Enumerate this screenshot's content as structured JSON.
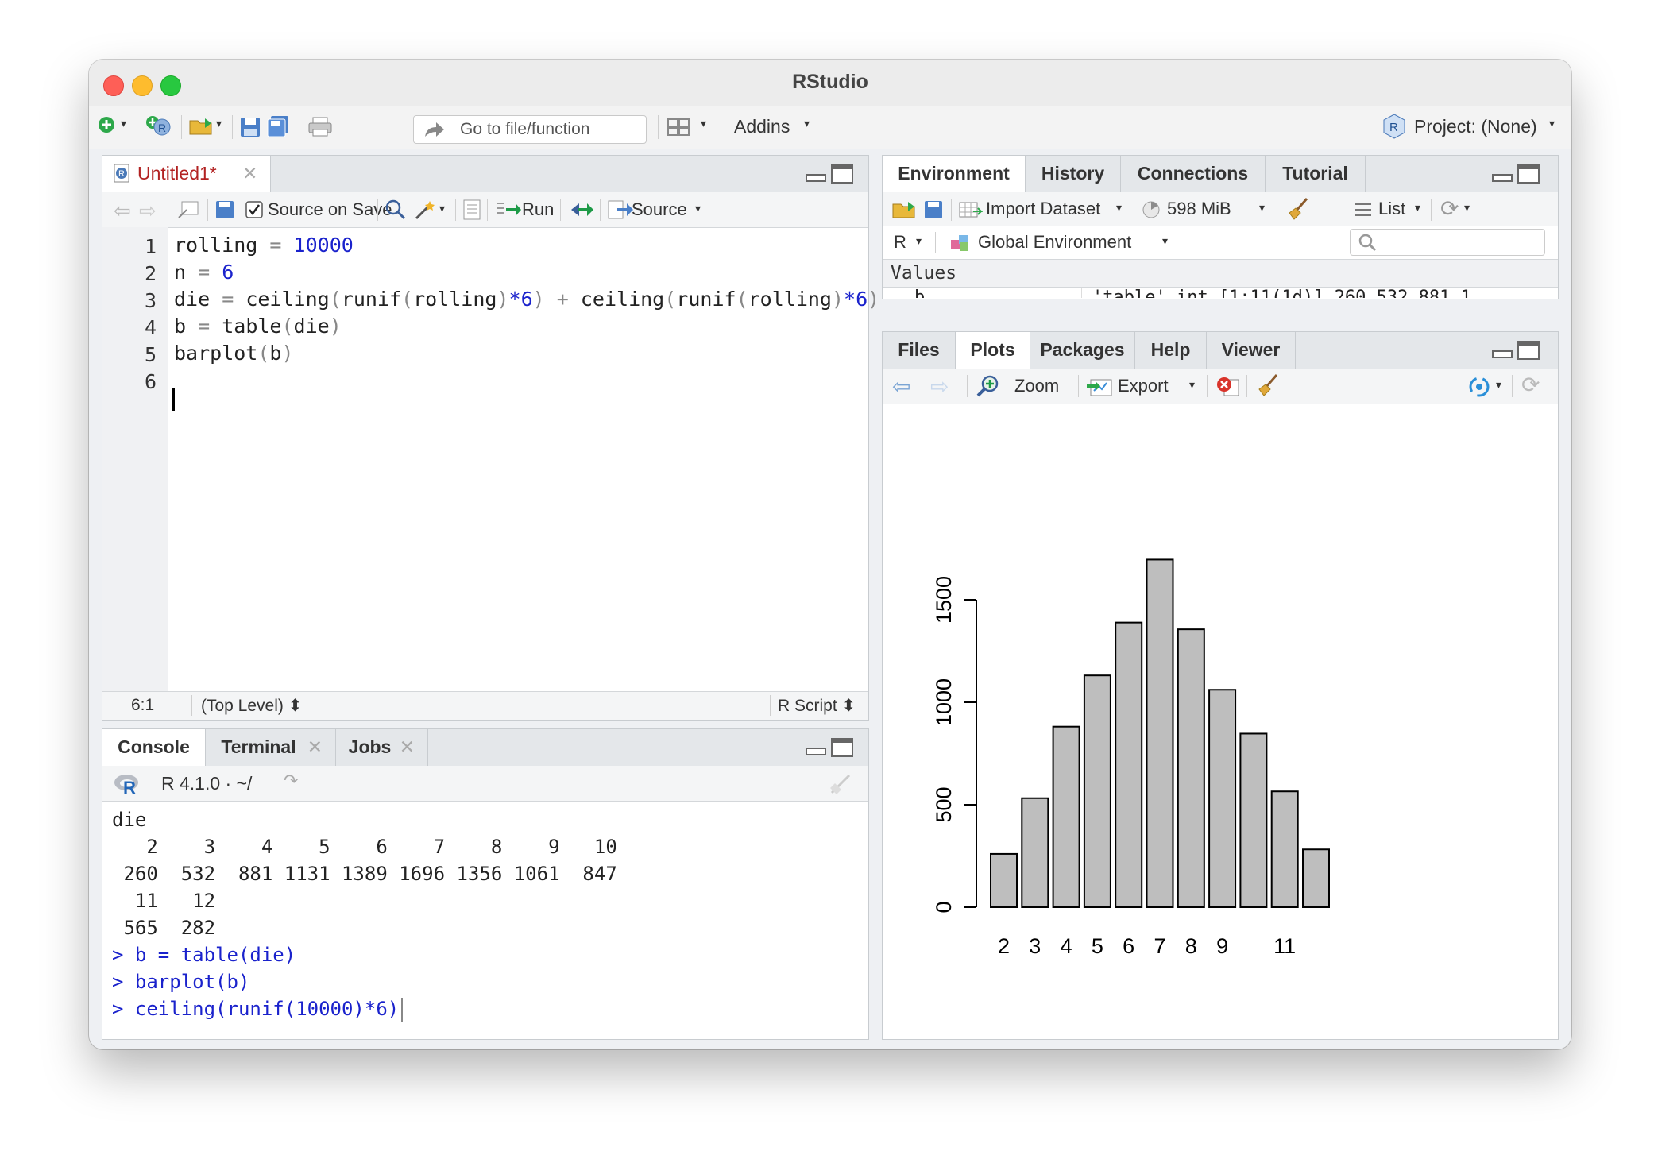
{
  "window": {
    "title": "RStudio"
  },
  "toolbar": {
    "goto_placeholder": "Go to file/function",
    "addins": "Addins",
    "project": "Project: (None)"
  },
  "editor": {
    "tab_label": "Untitled1*",
    "source_on_save": "Source on Save",
    "run": "Run",
    "source": "Source",
    "lines": [
      {
        "no": "1",
        "parts": [
          [
            "rolling ",
            ""
          ],
          [
            "=",
            "op"
          ],
          [
            " ",
            ""
          ],
          [
            "10000",
            "num"
          ]
        ]
      },
      {
        "no": "2",
        "parts": [
          [
            "n ",
            ""
          ],
          [
            "=",
            "op"
          ],
          [
            " ",
            ""
          ],
          [
            "6",
            "num"
          ]
        ]
      },
      {
        "no": "3",
        "parts": [
          [
            "die ",
            ""
          ],
          [
            "=",
            "op"
          ],
          [
            " ceiling",
            ""
          ],
          [
            "(",
            "op"
          ],
          [
            "runif",
            ""
          ],
          [
            "(",
            "op"
          ],
          [
            "rolling",
            ""
          ],
          [
            ")",
            "op"
          ],
          [
            "*6",
            "num"
          ],
          [
            ")",
            "op"
          ],
          [
            " ",
            ""
          ],
          [
            "+",
            "op"
          ],
          [
            " ceiling",
            ""
          ],
          [
            "(",
            "op"
          ],
          [
            "runif",
            ""
          ],
          [
            "(",
            "op"
          ],
          [
            "rolling",
            ""
          ],
          [
            ")",
            "op"
          ],
          [
            "*6",
            "num"
          ],
          [
            ")",
            "op"
          ]
        ]
      },
      {
        "no": "4",
        "parts": [
          [
            "b ",
            ""
          ],
          [
            "=",
            "op"
          ],
          [
            " table",
            ""
          ],
          [
            "(",
            "op"
          ],
          [
            "die",
            ""
          ],
          [
            ")",
            "op"
          ]
        ]
      },
      {
        "no": "5",
        "parts": [
          [
            "barplot",
            ""
          ],
          [
            "(",
            "op"
          ],
          [
            "b",
            ""
          ],
          [
            ")",
            "op"
          ]
        ]
      },
      {
        "no": "6",
        "parts": []
      }
    ],
    "status_pos": "6:1",
    "status_level": "(Top Level) ⬍",
    "status_type": "R Script ⬍"
  },
  "console": {
    "tabs": [
      "Console",
      "Terminal",
      "Jobs"
    ],
    "version": "R 4.1.0 · ~/",
    "output": [
      {
        "text": "die",
        "cls": ""
      },
      {
        "text": "   2    3    4    5    6    7    8    9   10",
        "cls": ""
      },
      {
        "text": " 260  532  881 1131 1389 1696 1356 1061  847",
        "cls": ""
      },
      {
        "text": "  11   12",
        "cls": ""
      },
      {
        "text": " 565  282",
        "cls": ""
      },
      {
        "text": "> b = table(die)",
        "cls": "blue"
      },
      {
        "text": "> barplot(b)",
        "cls": "blue"
      },
      {
        "text": "> ceiling(runif(10000)*6)",
        "cls": "blue"
      }
    ]
  },
  "env_pane": {
    "tabs": [
      "Environment",
      "History",
      "Connections",
      "Tutorial"
    ],
    "import_dataset": "Import Dataset",
    "memory": "598 MiB",
    "view": "List",
    "lang": "R",
    "scope": "Global Environment",
    "section": "Values",
    "row_name": "b",
    "row_value": "'table' int [1:11(1d)] 260 532 881 1"
  },
  "plots_pane": {
    "tabs": [
      "Files",
      "Plots",
      "Packages",
      "Help",
      "Viewer"
    ],
    "zoom": "Zoom",
    "export": "Export"
  },
  "chart_data": {
    "type": "bar",
    "categories": [
      "2",
      "3",
      "4",
      "5",
      "6",
      "7",
      "8",
      "9",
      "10",
      "11",
      "12"
    ],
    "values": [
      260,
      532,
      881,
      1131,
      1389,
      1696,
      1356,
      1061,
      847,
      565,
      282
    ],
    "visible_tick_labels": [
      "2",
      "3",
      "4",
      "5",
      "6",
      "7",
      "8",
      "9",
      "",
      "11",
      ""
    ],
    "yticks": [
      "0",
      "500",
      "1000",
      "1500"
    ],
    "ylim": [
      0,
      1700
    ],
    "bar_color": "#bebebe"
  },
  "colors": {
    "accent": "#1a22cc",
    "tab_modified": "#b22222"
  }
}
